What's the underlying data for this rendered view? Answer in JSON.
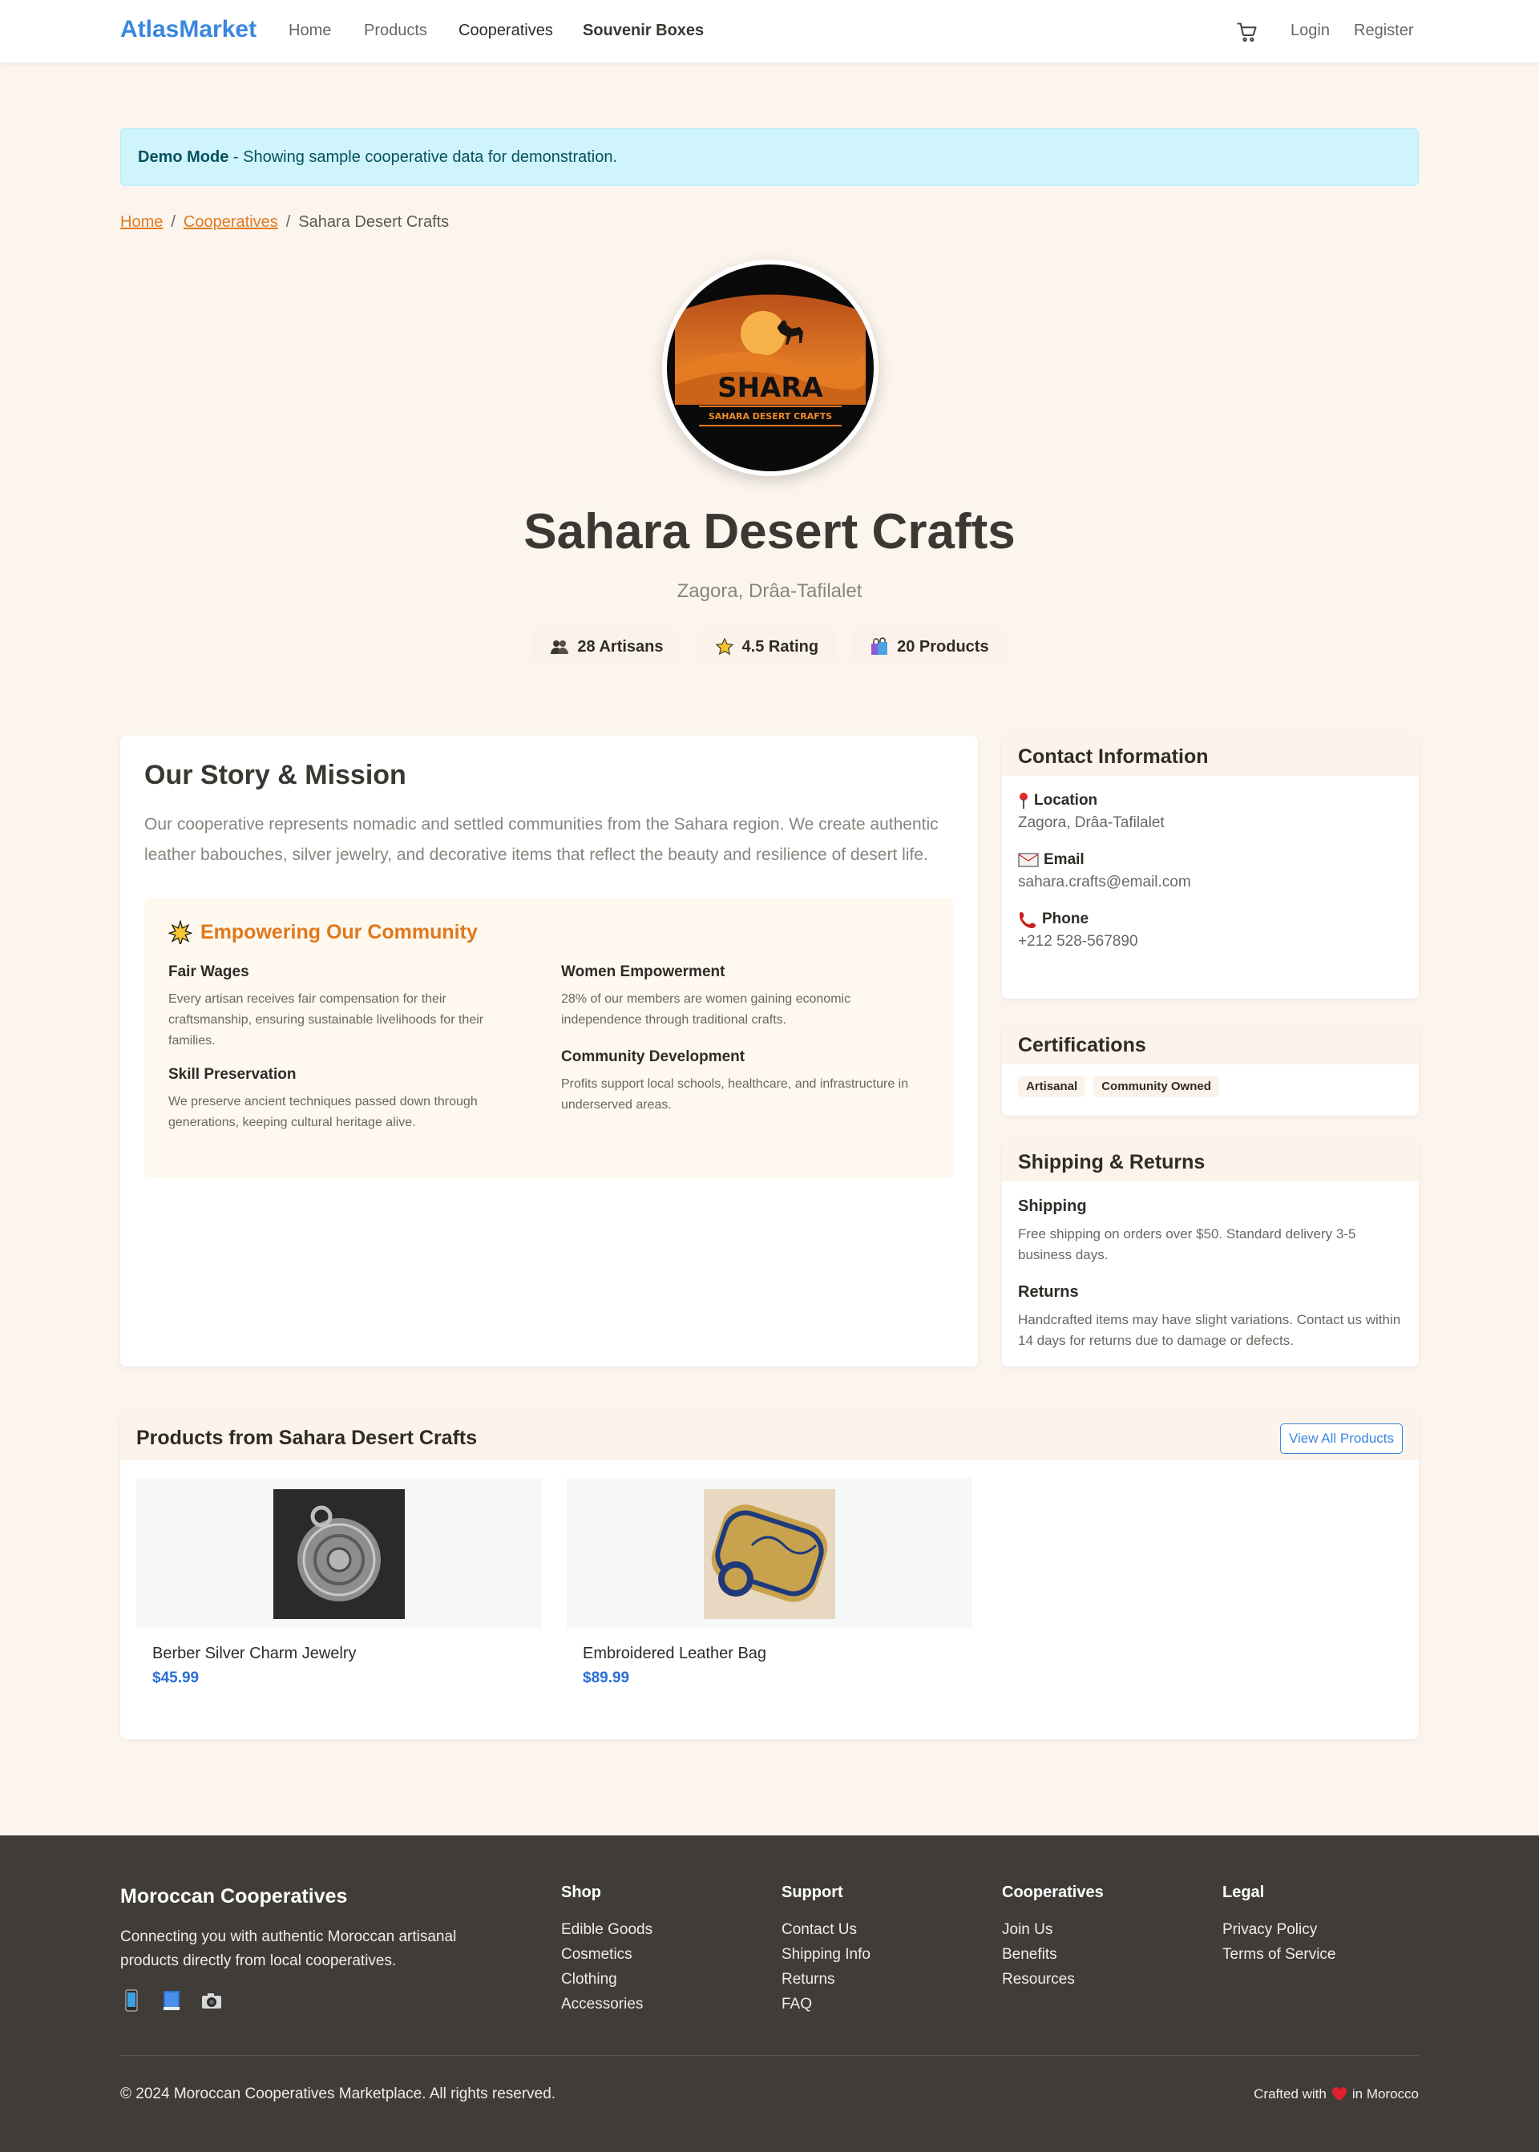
{
  "nav": {
    "brand": "AtlasMarket",
    "links": [
      "Home",
      "Products",
      "Cooperatives",
      "Souvenir Boxes"
    ],
    "login": "Login",
    "register": "Register"
  },
  "alert": {
    "strong": "Demo Mode",
    "text": " - Showing sample cooperative data for demonstration."
  },
  "breadcrumb": {
    "home": "Home",
    "cooperatives": "Cooperatives",
    "current": "Sahara Desert Crafts",
    "separator": "/"
  },
  "logo": {
    "name": "SHARA",
    "tagline": "SAHARA DESERT CRAFTS"
  },
  "coop": {
    "name": "Sahara Desert Crafts",
    "region": "Zagora, Drâa-Tafilalet",
    "stats": [
      {
        "icon": "people-icon",
        "label": "28 Artisans"
      },
      {
        "icon": "star-icon",
        "label": "4.5 Rating"
      },
      {
        "icon": "shopping-bags-icon",
        "label": "20 Products"
      }
    ]
  },
  "story": {
    "title": "Our Story & Mission",
    "text": "Our cooperative represents nomadic and settled communities from the Sahara region. We create authentic leather babouches, silver jewelry, and decorative items that reflect the beauty and resilience of desert life.",
    "empower_title": "Empowering Our Community",
    "items": [
      {
        "title": "Fair Wages",
        "text": "Every artisan receives fair compensation for their craftsmanship, ensuring sustainable livelihoods for their families."
      },
      {
        "title": "Women Empowerment",
        "text": "28% of our members are women gaining economic independence through traditional crafts."
      },
      {
        "title": "Skill Preservation",
        "text": "We preserve ancient techniques passed down through generations, keeping cultural heritage alive."
      },
      {
        "title": "Community Development",
        "text": "Profits support local schools, healthcare, and infrastructure in underserved areas."
      }
    ]
  },
  "contact": {
    "title": "Contact Information",
    "location_label": "Location",
    "location": "Zagora, Drâa-Tafilalet",
    "email_label": "Email",
    "email": "sahara.crafts@email.com",
    "phone_label": "Phone",
    "phone": "+212 528-567890"
  },
  "certifications": {
    "title": "Certifications",
    "badges": [
      "Artisanal",
      "Community Owned"
    ]
  },
  "shipping": {
    "title": "Shipping & Returns",
    "shipping_title": "Shipping",
    "shipping_text": "Free shipping on orders over $50. Standard delivery 3-5 business days.",
    "returns_title": "Returns",
    "returns_text": "Handcrafted items may have slight variations. Contact us within 14 days for returns due to damage or defects."
  },
  "products": {
    "title": "Products from Sahara Desert Crafts",
    "view_all": "View All Products",
    "items": [
      {
        "name": "Berber Silver Charm Jewelry",
        "price": "$45.99"
      },
      {
        "name": "Embroidered Leather Bag",
        "price": "$89.99"
      }
    ]
  },
  "footer": {
    "brand": "Moroccan Cooperatives",
    "desc": "Connecting you with authentic Moroccan artisanal products directly from local cooperatives.",
    "columns": [
      {
        "title": "Shop",
        "links": [
          "Edible Goods",
          "Cosmetics",
          "Clothing",
          "Accessories"
        ]
      },
      {
        "title": "Support",
        "links": [
          "Contact Us",
          "Shipping Info",
          "Returns",
          "FAQ"
        ]
      },
      {
        "title": "Cooperatives",
        "links": [
          "Join Us",
          "Benefits",
          "Resources"
        ]
      },
      {
        "title": "Legal",
        "links": [
          "Privacy Policy",
          "Terms of Service"
        ]
      }
    ],
    "copyright": "© 2024 Moroccan Cooperatives Marketplace. All rights reserved.",
    "crafted_before": "Crafted with",
    "crafted_after": "in Morocco"
  },
  "colors": {
    "brand": "#3a86e0",
    "accent": "#e0781c",
    "price": "#2a6fd6",
    "footer_bg": "#403d39"
  }
}
